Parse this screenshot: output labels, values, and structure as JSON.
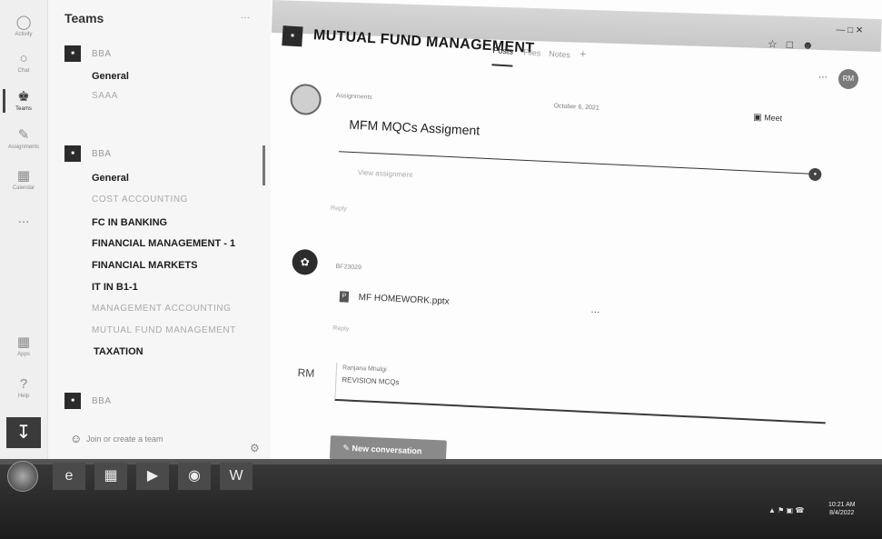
{
  "rail": {
    "items": [
      {
        "icon": "bell-icon",
        "label": "Activity"
      },
      {
        "icon": "chat-icon",
        "label": "Chat"
      },
      {
        "icon": "teams-icon",
        "label": "Teams"
      },
      {
        "icon": "assignments-icon",
        "label": "Assignments"
      },
      {
        "icon": "calendar-icon",
        "label": "Calendar"
      },
      {
        "icon": "more-icon",
        "label": "..."
      },
      {
        "icon": "apps-icon",
        "label": "Apps"
      },
      {
        "icon": "help-icon",
        "label": "Help"
      }
    ]
  },
  "teams_panel": {
    "title": "Teams",
    "more": "···",
    "team1": {
      "name": "BBA"
    },
    "team1_channels": [
      "General",
      "SAAA"
    ],
    "team2": {
      "name": "BBA"
    },
    "team2_channels": [
      "General",
      "COST ACCOUNTING",
      "FC IN BANKING",
      "FINANCIAL MANAGEMENT - 1",
      "FINANCIAL MARKETS",
      "IT IN B1-1",
      "MANAGEMENT ACCOUNTING",
      "MUTUAL FUND MANAGEMENT",
      "TAXATION"
    ],
    "team3": {
      "name": "BBA"
    },
    "join_label": "Join or create a team"
  },
  "channel": {
    "name": "MUTUAL FUND MANAGEMENT",
    "tabs": [
      "Posts",
      "Files",
      "Notes"
    ],
    "add_tab": "+",
    "user_initials": "RM"
  },
  "posts": [
    {
      "author": "Assignments",
      "date_right": "October 6, 2021",
      "meet_label": "Meet",
      "card_title": "MFM MQCs Assigment",
      "view_label": "View assignment",
      "reply": "Reply"
    },
    {
      "author": "BF23029",
      "file_name": "MF HOMEWORK.pptx",
      "reply": "Reply"
    },
    {
      "initials": "RM",
      "author": "Ranjana Mhalgi",
      "text": "REVISION MCQs"
    }
  ],
  "new_conversation": "New conversation",
  "taskbar": {
    "apps": [
      "IE",
      "Explorer",
      "Media",
      "Chrome",
      "Word"
    ],
    "time": "10:21 AM",
    "date": "8/4/2022"
  }
}
